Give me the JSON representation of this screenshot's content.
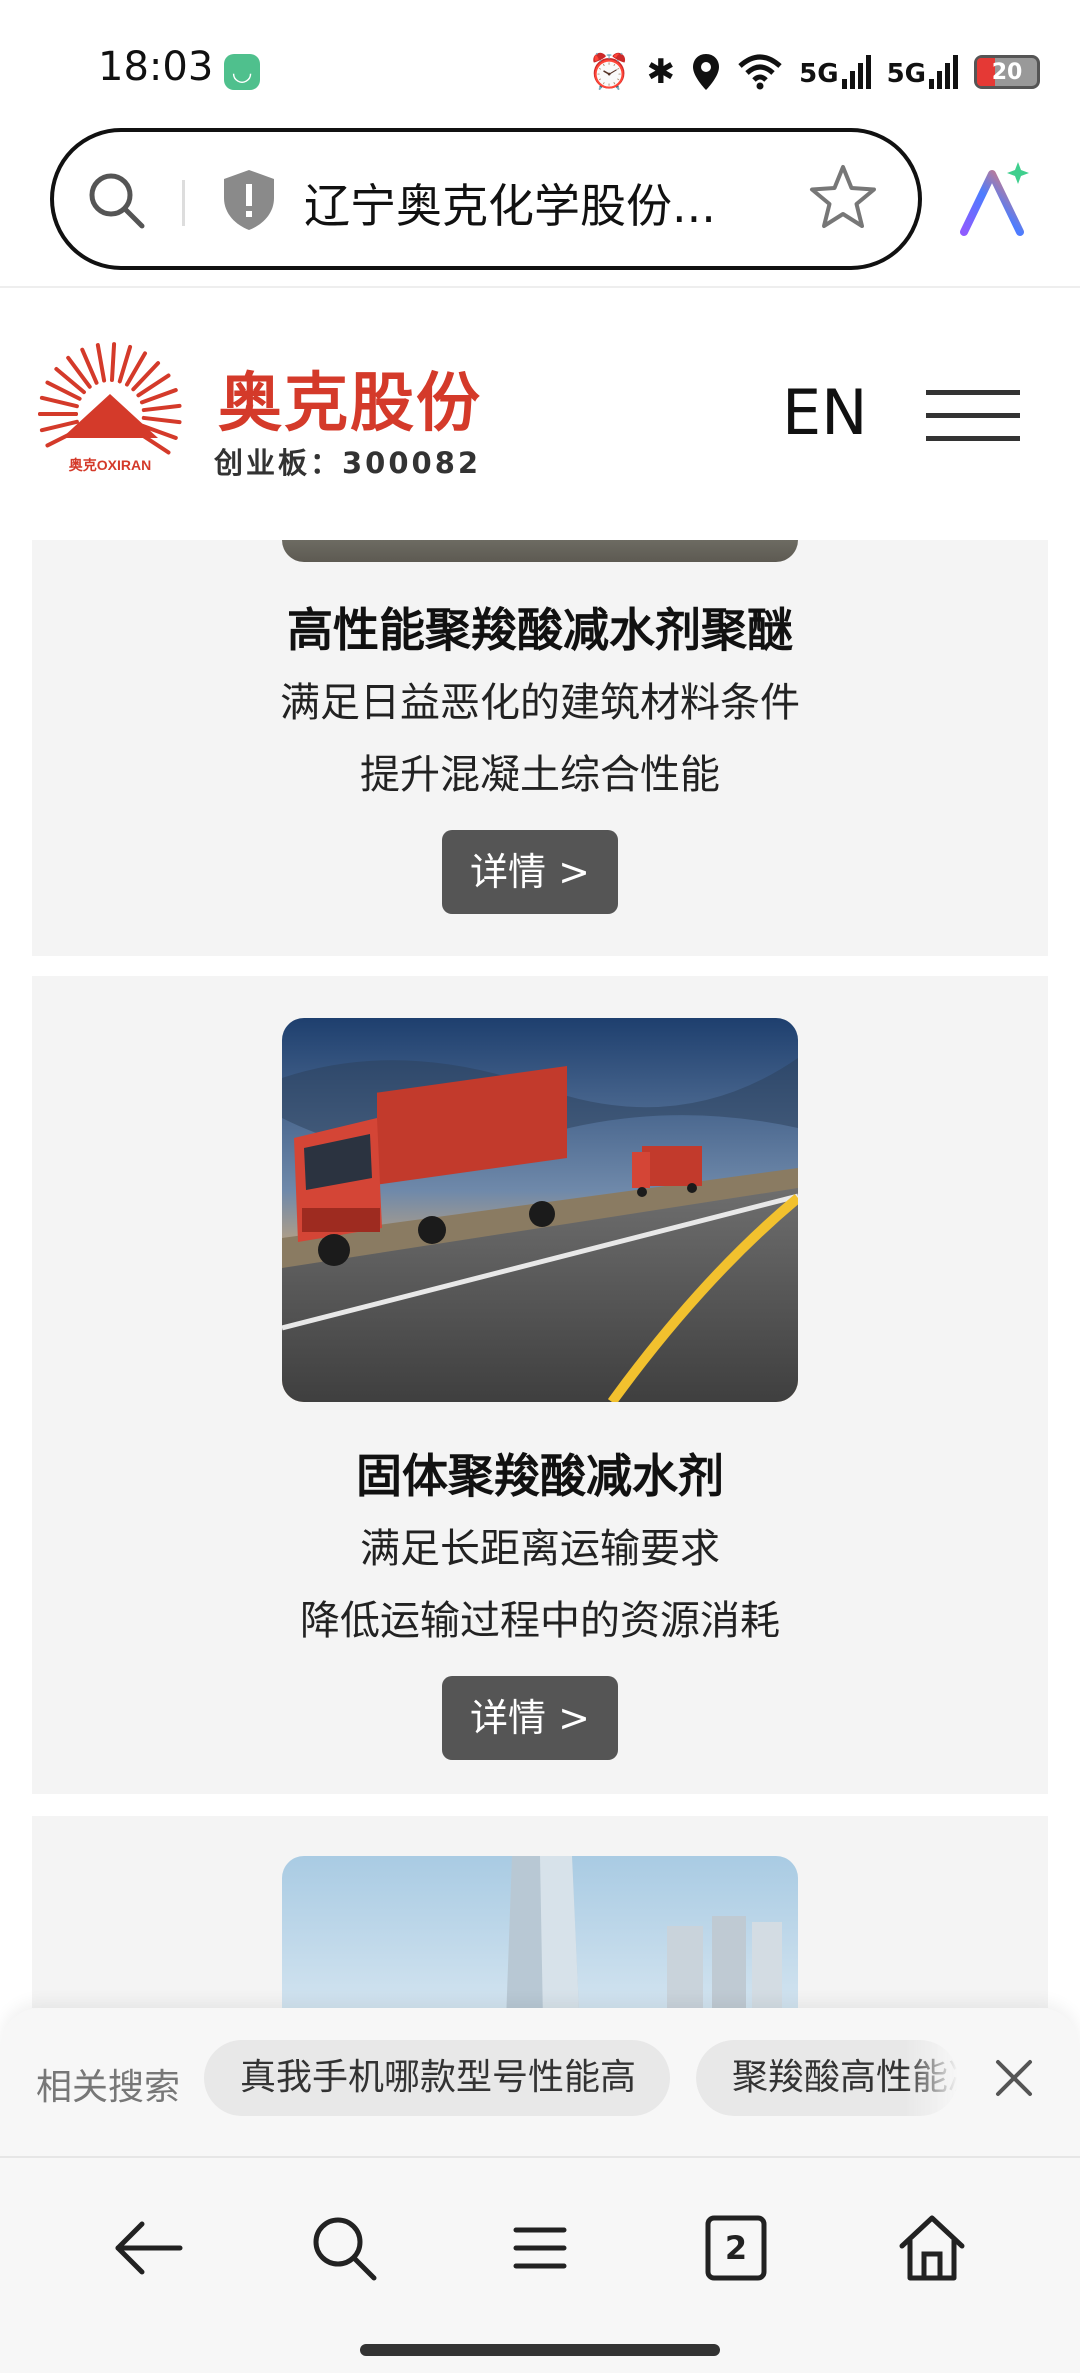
{
  "status_bar": {
    "time": "18:03",
    "network_1": "5G",
    "network_2": "5G",
    "battery": "20"
  },
  "address_bar": {
    "url_text": "辽宁奥克化学股份..."
  },
  "site_header": {
    "logo_name": "奥克股份",
    "logo_code": "创业板：300082",
    "logo_small": "奥克OXIRAN",
    "lang": "EN"
  },
  "products": [
    {
      "title": "高性能聚羧酸减水剂聚醚",
      "line1": "满足日益恶化的建筑材料条件",
      "line2": "提升混凝土综合性能",
      "button": "详情 >"
    },
    {
      "title": "固体聚羧酸减水剂",
      "line1": "满足长距离运输要求",
      "line2": "降低运输过程中的资源消耗",
      "button": "详情 >"
    }
  ],
  "related_search": {
    "label": "相关搜索",
    "chips": [
      "真我手机哪款型号性能高",
      "聚羧酸高性能减水剂"
    ]
  },
  "bottom_nav": {
    "tab_count": "2"
  },
  "colors": {
    "brand_red": "#d43a2a",
    "button_gray": "#555555",
    "card_bg": "#f4f4f4"
  }
}
